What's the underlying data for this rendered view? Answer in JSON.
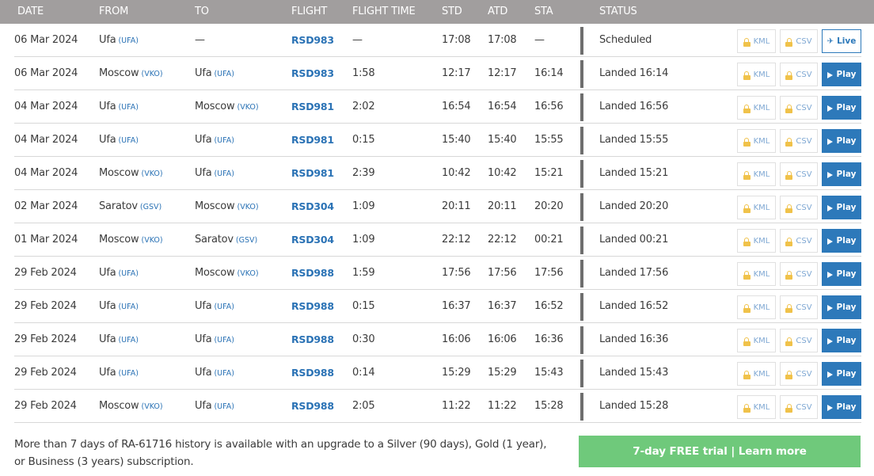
{
  "header": {
    "columns": [
      "DATE",
      "FROM",
      "TO",
      "FLIGHT",
      "FLIGHT TIME",
      "STD",
      "ATD",
      "STA",
      "STATUS"
    ]
  },
  "buttons": {
    "kml_label": "KML",
    "csv_label": "CSV",
    "play_label": "Play",
    "live_label": "Live"
  },
  "rows": [
    {
      "date": "06 Mar 2024",
      "from": "Ufa",
      "from_code": "(UFA)",
      "to": "—",
      "to_code": "",
      "flight": "RSD983",
      "flight_time": "—",
      "std": "17:08",
      "atd": "17:08",
      "sta": "—",
      "status": "Scheduled",
      "action": "live"
    },
    {
      "date": "06 Mar 2024",
      "from": "Moscow",
      "from_code": "(VKO)",
      "to": "Ufa",
      "to_code": "(UFA)",
      "flight": "RSD983",
      "flight_time": "1:58",
      "std": "12:17",
      "atd": "12:17",
      "sta": "16:14",
      "status": "Landed 16:14",
      "action": "play"
    },
    {
      "date": "04 Mar 2024",
      "from": "Ufa",
      "from_code": "(UFA)",
      "to": "Moscow",
      "to_code": "(VKO)",
      "flight": "RSD981",
      "flight_time": "2:02",
      "std": "16:54",
      "atd": "16:54",
      "sta": "16:56",
      "status": "Landed 16:56",
      "action": "play"
    },
    {
      "date": "04 Mar 2024",
      "from": "Ufa",
      "from_code": "(UFA)",
      "to": "Ufa",
      "to_code": "(UFA)",
      "flight": "RSD981",
      "flight_time": "0:15",
      "std": "15:40",
      "atd": "15:40",
      "sta": "15:55",
      "status": "Landed 15:55",
      "action": "play"
    },
    {
      "date": "04 Mar 2024",
      "from": "Moscow",
      "from_code": "(VKO)",
      "to": "Ufa",
      "to_code": "(UFA)",
      "flight": "RSD981",
      "flight_time": "2:39",
      "std": "10:42",
      "atd": "10:42",
      "sta": "15:21",
      "status": "Landed 15:21",
      "action": "play"
    },
    {
      "date": "02 Mar 2024",
      "from": "Saratov",
      "from_code": "(GSV)",
      "to": "Moscow",
      "to_code": "(VKO)",
      "flight": "RSD304",
      "flight_time": "1:09",
      "std": "20:11",
      "atd": "20:11",
      "sta": "20:20",
      "status": "Landed 20:20",
      "action": "play"
    },
    {
      "date": "01 Mar 2024",
      "from": "Moscow",
      "from_code": "(VKO)",
      "to": "Saratov",
      "to_code": "(GSV)",
      "flight": "RSD304",
      "flight_time": "1:09",
      "std": "22:12",
      "atd": "22:12",
      "sta": "00:21",
      "status": "Landed 00:21",
      "action": "play"
    },
    {
      "date": "29 Feb 2024",
      "from": "Ufa",
      "from_code": "(UFA)",
      "to": "Moscow",
      "to_code": "(VKO)",
      "flight": "RSD988",
      "flight_time": "1:59",
      "std": "17:56",
      "atd": "17:56",
      "sta": "17:56",
      "status": "Landed 17:56",
      "action": "play"
    },
    {
      "date": "29 Feb 2024",
      "from": "Ufa",
      "from_code": "(UFA)",
      "to": "Ufa",
      "to_code": "(UFA)",
      "flight": "RSD988",
      "flight_time": "0:15",
      "std": "16:37",
      "atd": "16:37",
      "sta": "16:52",
      "status": "Landed 16:52",
      "action": "play"
    },
    {
      "date": "29 Feb 2024",
      "from": "Ufa",
      "from_code": "(UFA)",
      "to": "Ufa",
      "to_code": "(UFA)",
      "flight": "RSD988",
      "flight_time": "0:30",
      "std": "16:06",
      "atd": "16:06",
      "sta": "16:36",
      "status": "Landed 16:36",
      "action": "play"
    },
    {
      "date": "29 Feb 2024",
      "from": "Ufa",
      "from_code": "(UFA)",
      "to": "Ufa",
      "to_code": "(UFA)",
      "flight": "RSD988",
      "flight_time": "0:14",
      "std": "15:29",
      "atd": "15:29",
      "sta": "15:43",
      "status": "Landed 15:43",
      "action": "play"
    },
    {
      "date": "29 Feb 2024",
      "from": "Moscow",
      "from_code": "(VKO)",
      "to": "Ufa",
      "to_code": "(UFA)",
      "flight": "RSD988",
      "flight_time": "2:05",
      "std": "11:22",
      "atd": "11:22",
      "sta": "15:28",
      "status": "Landed 15:28",
      "action": "play"
    }
  ],
  "footer": {
    "upgrade_text": "More than 7 days of RA-61716 history is available with an upgrade to a Silver (90 days), Gold (1 year), or Business (3 years) subscription.",
    "trial_button": "7-day FREE trial | Learn more"
  },
  "colors": {
    "header_bg": "#a19e9e",
    "link": "#2a72b5",
    "play_button": "#2d79ba",
    "trial_button": "#6fc97b",
    "lock": "#f0c24a"
  }
}
